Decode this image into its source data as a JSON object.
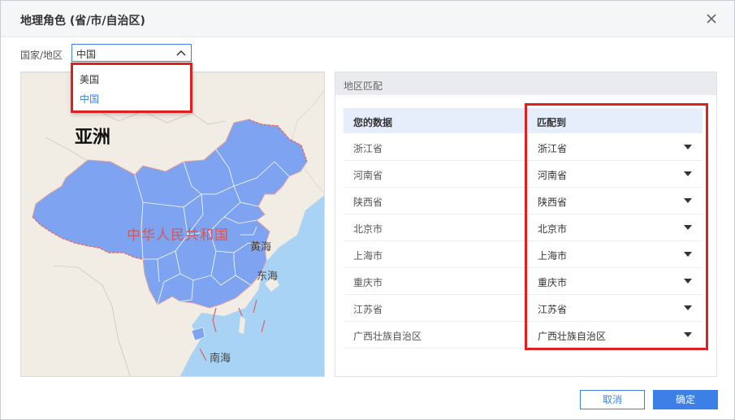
{
  "dialog": {
    "title": "地理角色 (省/市/自治区)",
    "country_label": "国家/地区",
    "country_value": "中国",
    "country_options": [
      "美国",
      "中国"
    ]
  },
  "map": {
    "labels": {
      "asia": "亚洲",
      "china": "中华人民共和国",
      "yellow_sea": "黄海",
      "east_sea": "东海",
      "south_sea": "南海"
    }
  },
  "panel": {
    "title": "地区匹配",
    "col_data": "您的数据",
    "col_match": "匹配到",
    "rows": [
      {
        "data": "浙江省",
        "match": "浙江省"
      },
      {
        "data": "河南省",
        "match": "河南省"
      },
      {
        "data": "陕西省",
        "match": "陕西省"
      },
      {
        "data": "北京市",
        "match": "北京市"
      },
      {
        "data": "上海市",
        "match": "上海市"
      },
      {
        "data": "重庆市",
        "match": "重庆市"
      },
      {
        "data": "江苏省",
        "match": "江苏省"
      },
      {
        "data": "广西壮族自治区",
        "match": "广西壮族自治区"
      }
    ]
  },
  "footer": {
    "cancel": "取消",
    "ok": "确定"
  },
  "colors": {
    "accent": "#3c7fe6",
    "highlight": "#e02020",
    "region_fill": "#7ea3f0"
  }
}
